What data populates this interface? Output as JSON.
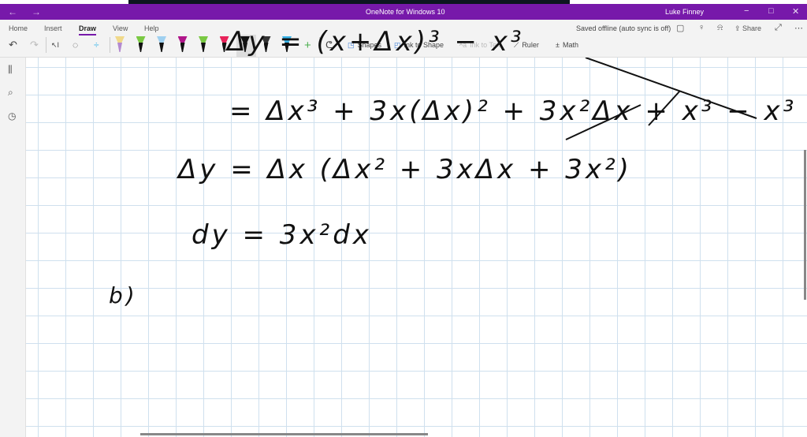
{
  "window": {
    "title": "OneNote for Windows 10",
    "user": "Luke Finney",
    "back": "←",
    "forward": "→",
    "minimize": "−",
    "maximize": "□",
    "close": "✕"
  },
  "ribbon": {
    "tabs": [
      "Home",
      "Insert",
      "Draw",
      "View",
      "Help"
    ],
    "active_tab": "Draw",
    "status": "Saved offline (auto sync is off)",
    "share": "Share",
    "tools": {
      "shapes": "Shapes",
      "ink_to_shape": "Ink to Shape",
      "ink_to_text": "Ink to Text",
      "ruler": "Ruler",
      "math": "Math"
    },
    "pens": [
      {
        "tip": "#f0d98a",
        "body": "#b48ad0"
      },
      {
        "tip": "#7ac943",
        "body": "#111"
      },
      {
        "tip": "#9fd0f0",
        "body": "#111"
      },
      {
        "tip": "#b0168a",
        "body": "#111"
      },
      {
        "tip": "#7ac943",
        "body": "#111"
      },
      {
        "tip": "#e8235a",
        "body": "#111"
      },
      {
        "tip": "#111",
        "body": "#111"
      },
      {
        "tip": "#333",
        "body": "#111"
      },
      {
        "tip": "#39b4e8",
        "body": "#111"
      }
    ]
  },
  "ink": {
    "line1": "= Δx³ + 3x(Δx)² + 3x²Δx + x³ − x³",
    "line2": "Δy = Δx (Δx² + 3xΔx + 3x²)",
    "line3": "dy =  3x²dx",
    "line4": "b)"
  }
}
